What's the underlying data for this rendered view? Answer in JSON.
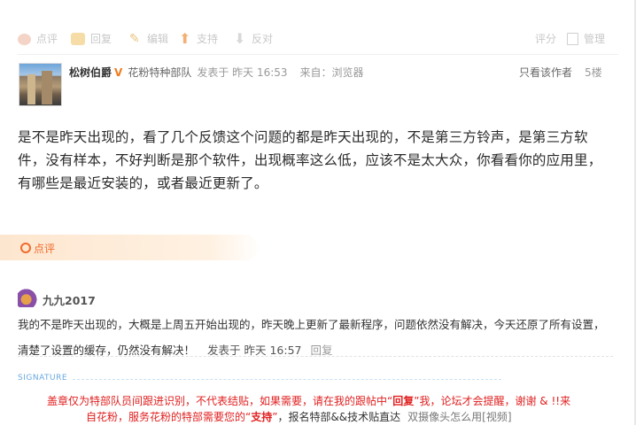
{
  "actions": {
    "comment": "点评",
    "reply": "回复",
    "edit": "编辑",
    "support": "支持",
    "oppose": "反对",
    "rate": "评分",
    "manage": "管理"
  },
  "post": {
    "author": "松树伯爵",
    "badge": "V",
    "team": "花粉特种部队",
    "posted": "发表于 昨天 16:53",
    "source": "来自：浏览器",
    "only_author": "只看该作者",
    "floor": "5楼",
    "content": "是不是昨天出现的，看了几个反馈这个问题的都是昨天出现的，不是第三方铃声，是第三方软件，没有样本，不好判断是那个软件，出现概率这么低，应该不是太大众，你看看你的应用里，有哪些是最近安装的，或者最近更新了。"
  },
  "review": {
    "label": "点评"
  },
  "comment": {
    "user": "九九2017",
    "text": "我的不是昨天出现的，大概是上周五开始出现的，昨天晚上更新了最新程序，问题依然没有解决，今天还原了所有设置，清楚了设置的缓存，仍然没有解决！",
    "time": "发表于 昨天 16:57",
    "reply": "回复"
  },
  "signature": {
    "title": "SIGNATURE",
    "line1_a": "盖章仅为特部队员间跟进识别，不代表结贴，如果需要，请在我的跟帖中“",
    "line1_b": "回复",
    "line1_c": "”我，论坛才会提醒，谢谢 & !!来",
    "line2_a": "自花粉，服务花粉的特部需要您的“",
    "line2_b": "支持",
    "line2_c": "”",
    "line2_d": "，报名特部&&技术贴直达",
    "line2_e": "双摄像头怎么用[视频]"
  }
}
